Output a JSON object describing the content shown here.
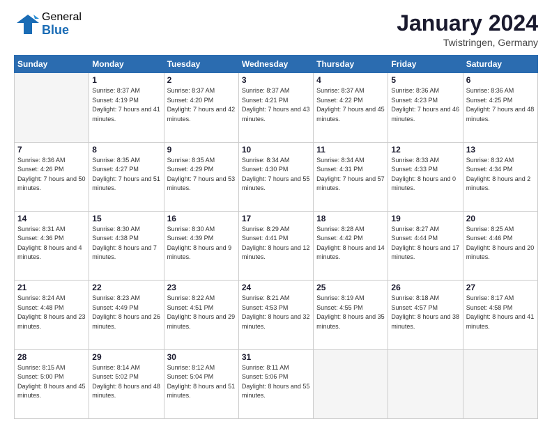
{
  "header": {
    "logo_general": "General",
    "logo_blue": "Blue",
    "month_title": "January 2024",
    "location": "Twistringen, Germany"
  },
  "weekdays": [
    "Sunday",
    "Monday",
    "Tuesday",
    "Wednesday",
    "Thursday",
    "Friday",
    "Saturday"
  ],
  "weeks": [
    [
      {
        "day": "",
        "sunrise": "",
        "sunset": "",
        "daylight": "",
        "empty": true
      },
      {
        "day": "1",
        "sunrise": "Sunrise: 8:37 AM",
        "sunset": "Sunset: 4:19 PM",
        "daylight": "Daylight: 7 hours and 41 minutes."
      },
      {
        "day": "2",
        "sunrise": "Sunrise: 8:37 AM",
        "sunset": "Sunset: 4:20 PM",
        "daylight": "Daylight: 7 hours and 42 minutes."
      },
      {
        "day": "3",
        "sunrise": "Sunrise: 8:37 AM",
        "sunset": "Sunset: 4:21 PM",
        "daylight": "Daylight: 7 hours and 43 minutes."
      },
      {
        "day": "4",
        "sunrise": "Sunrise: 8:37 AM",
        "sunset": "Sunset: 4:22 PM",
        "daylight": "Daylight: 7 hours and 45 minutes."
      },
      {
        "day": "5",
        "sunrise": "Sunrise: 8:36 AM",
        "sunset": "Sunset: 4:23 PM",
        "daylight": "Daylight: 7 hours and 46 minutes."
      },
      {
        "day": "6",
        "sunrise": "Sunrise: 8:36 AM",
        "sunset": "Sunset: 4:25 PM",
        "daylight": "Daylight: 7 hours and 48 minutes."
      }
    ],
    [
      {
        "day": "7",
        "sunrise": "Sunrise: 8:36 AM",
        "sunset": "Sunset: 4:26 PM",
        "daylight": "Daylight: 7 hours and 50 minutes."
      },
      {
        "day": "8",
        "sunrise": "Sunrise: 8:35 AM",
        "sunset": "Sunset: 4:27 PM",
        "daylight": "Daylight: 7 hours and 51 minutes."
      },
      {
        "day": "9",
        "sunrise": "Sunrise: 8:35 AM",
        "sunset": "Sunset: 4:29 PM",
        "daylight": "Daylight: 7 hours and 53 minutes."
      },
      {
        "day": "10",
        "sunrise": "Sunrise: 8:34 AM",
        "sunset": "Sunset: 4:30 PM",
        "daylight": "Daylight: 7 hours and 55 minutes."
      },
      {
        "day": "11",
        "sunrise": "Sunrise: 8:34 AM",
        "sunset": "Sunset: 4:31 PM",
        "daylight": "Daylight: 7 hours and 57 minutes."
      },
      {
        "day": "12",
        "sunrise": "Sunrise: 8:33 AM",
        "sunset": "Sunset: 4:33 PM",
        "daylight": "Daylight: 8 hours and 0 minutes."
      },
      {
        "day": "13",
        "sunrise": "Sunrise: 8:32 AM",
        "sunset": "Sunset: 4:34 PM",
        "daylight": "Daylight: 8 hours and 2 minutes."
      }
    ],
    [
      {
        "day": "14",
        "sunrise": "Sunrise: 8:31 AM",
        "sunset": "Sunset: 4:36 PM",
        "daylight": "Daylight: 8 hours and 4 minutes."
      },
      {
        "day": "15",
        "sunrise": "Sunrise: 8:30 AM",
        "sunset": "Sunset: 4:38 PM",
        "daylight": "Daylight: 8 hours and 7 minutes."
      },
      {
        "day": "16",
        "sunrise": "Sunrise: 8:30 AM",
        "sunset": "Sunset: 4:39 PM",
        "daylight": "Daylight: 8 hours and 9 minutes."
      },
      {
        "day": "17",
        "sunrise": "Sunrise: 8:29 AM",
        "sunset": "Sunset: 4:41 PM",
        "daylight": "Daylight: 8 hours and 12 minutes."
      },
      {
        "day": "18",
        "sunrise": "Sunrise: 8:28 AM",
        "sunset": "Sunset: 4:42 PM",
        "daylight": "Daylight: 8 hours and 14 minutes."
      },
      {
        "day": "19",
        "sunrise": "Sunrise: 8:27 AM",
        "sunset": "Sunset: 4:44 PM",
        "daylight": "Daylight: 8 hours and 17 minutes."
      },
      {
        "day": "20",
        "sunrise": "Sunrise: 8:25 AM",
        "sunset": "Sunset: 4:46 PM",
        "daylight": "Daylight: 8 hours and 20 minutes."
      }
    ],
    [
      {
        "day": "21",
        "sunrise": "Sunrise: 8:24 AM",
        "sunset": "Sunset: 4:48 PM",
        "daylight": "Daylight: 8 hours and 23 minutes."
      },
      {
        "day": "22",
        "sunrise": "Sunrise: 8:23 AM",
        "sunset": "Sunset: 4:49 PM",
        "daylight": "Daylight: 8 hours and 26 minutes."
      },
      {
        "day": "23",
        "sunrise": "Sunrise: 8:22 AM",
        "sunset": "Sunset: 4:51 PM",
        "daylight": "Daylight: 8 hours and 29 minutes."
      },
      {
        "day": "24",
        "sunrise": "Sunrise: 8:21 AM",
        "sunset": "Sunset: 4:53 PM",
        "daylight": "Daylight: 8 hours and 32 minutes."
      },
      {
        "day": "25",
        "sunrise": "Sunrise: 8:19 AM",
        "sunset": "Sunset: 4:55 PM",
        "daylight": "Daylight: 8 hours and 35 minutes."
      },
      {
        "day": "26",
        "sunrise": "Sunrise: 8:18 AM",
        "sunset": "Sunset: 4:57 PM",
        "daylight": "Daylight: 8 hours and 38 minutes."
      },
      {
        "day": "27",
        "sunrise": "Sunrise: 8:17 AM",
        "sunset": "Sunset: 4:58 PM",
        "daylight": "Daylight: 8 hours and 41 minutes."
      }
    ],
    [
      {
        "day": "28",
        "sunrise": "Sunrise: 8:15 AM",
        "sunset": "Sunset: 5:00 PM",
        "daylight": "Daylight: 8 hours and 45 minutes."
      },
      {
        "day": "29",
        "sunrise": "Sunrise: 8:14 AM",
        "sunset": "Sunset: 5:02 PM",
        "daylight": "Daylight: 8 hours and 48 minutes."
      },
      {
        "day": "30",
        "sunrise": "Sunrise: 8:12 AM",
        "sunset": "Sunset: 5:04 PM",
        "daylight": "Daylight: 8 hours and 51 minutes."
      },
      {
        "day": "31",
        "sunrise": "Sunrise: 8:11 AM",
        "sunset": "Sunset: 5:06 PM",
        "daylight": "Daylight: 8 hours and 55 minutes."
      },
      {
        "day": "",
        "sunrise": "",
        "sunset": "",
        "daylight": "",
        "empty": true
      },
      {
        "day": "",
        "sunrise": "",
        "sunset": "",
        "daylight": "",
        "empty": true
      },
      {
        "day": "",
        "sunrise": "",
        "sunset": "",
        "daylight": "",
        "empty": true
      }
    ]
  ]
}
